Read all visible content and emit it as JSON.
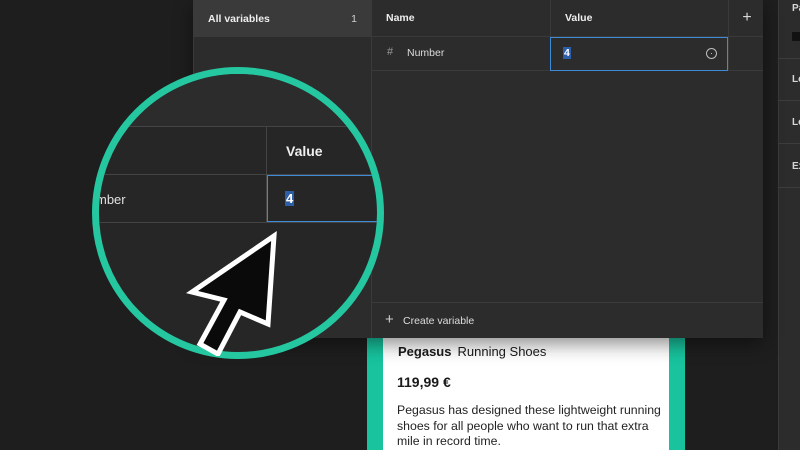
{
  "inspector": {
    "rows": [
      "Pa",
      "Le",
      "Le",
      "Ex"
    ]
  },
  "variables": {
    "sidebar": {
      "all_variables_label": "All variables",
      "all_variables_count": "1"
    },
    "table": {
      "col_name": "Name",
      "col_value": "Value",
      "add_icon": "plus-icon",
      "rows": [
        {
          "type_icon": "hash-icon",
          "name": "Number",
          "value": "4"
        }
      ],
      "create_label": "Create variable"
    }
  },
  "magnifier": {
    "value_header": "Value",
    "name_fragment": "mber",
    "value": "4",
    "accent": "#25c7a0"
  },
  "card": {
    "brand": "Pegasus",
    "product": "Running Shoes",
    "price": "119,99 €",
    "description": "Pegasus has designed these lightweight running shoes for all people who want to run that extra mile in record time.",
    "frame_color": "#18c39e"
  },
  "colors": {
    "selection": "#3d8bd6",
    "panel": "#2c2c2c",
    "canvas": "#1e1e1e"
  }
}
